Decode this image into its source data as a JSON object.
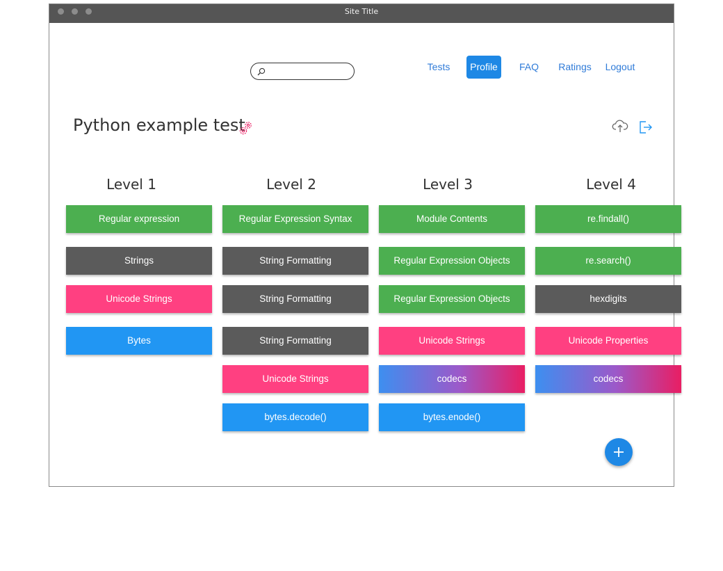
{
  "window": {
    "title": "Site Title"
  },
  "search": {
    "placeholder": ""
  },
  "nav": {
    "tests": "Tests",
    "profile": "Profile",
    "faq": "FAQ",
    "ratings": "Ratings",
    "logout": "Logout"
  },
  "page": {
    "title": "Python example test"
  },
  "icons": {
    "title": "gears-icon",
    "upload": "cloud-upload-icon",
    "exit": "exit-icon",
    "add": "plus-icon"
  },
  "colors": {
    "green": "#4caf50",
    "gray": "#5b5b5b",
    "pink": "#ff4081",
    "blue": "#2196f3",
    "accent": "#1e88e5"
  },
  "levels": [
    {
      "title": "Level 1",
      "items": [
        {
          "label": "Regular expression",
          "color": "green"
        },
        {
          "label": "Strings",
          "color": "gray"
        },
        {
          "label": "Unicode Strings",
          "color": "pink"
        },
        {
          "label": "Bytes",
          "color": "blue"
        }
      ]
    },
    {
      "title": "Level 2",
      "items": [
        {
          "label": "Regular Expression Syntax",
          "color": "green"
        },
        {
          "label": "String Formatting",
          "color": "gray"
        },
        {
          "label": "String Formatting",
          "color": "gray"
        },
        {
          "label": "String Formatting",
          "color": "gray"
        },
        {
          "label": "Unicode Strings",
          "color": "pink"
        },
        {
          "label": "bytes.decode()",
          "color": "blue"
        }
      ]
    },
    {
      "title": "Level 3",
      "items": [
        {
          "label": "Module Contents",
          "color": "green"
        },
        {
          "label": "Regular Expression Objects",
          "color": "green"
        },
        {
          "label": "Regular Expression Objects",
          "color": "green"
        },
        {
          "label": "Unicode Strings",
          "color": "pink"
        },
        {
          "label": "codecs",
          "color": "gradient"
        },
        {
          "label": "bytes.enode()",
          "color": "blue"
        }
      ]
    },
    {
      "title": "Level 4",
      "items": [
        {
          "label": "re.findall()",
          "color": "green"
        },
        {
          "label": "re.search()",
          "color": "green"
        },
        {
          "label": "hexdigits",
          "color": "gray"
        },
        {
          "label": "Unicode Properties",
          "color": "pink"
        },
        {
          "label": "codecs",
          "color": "gradient"
        }
      ]
    }
  ]
}
